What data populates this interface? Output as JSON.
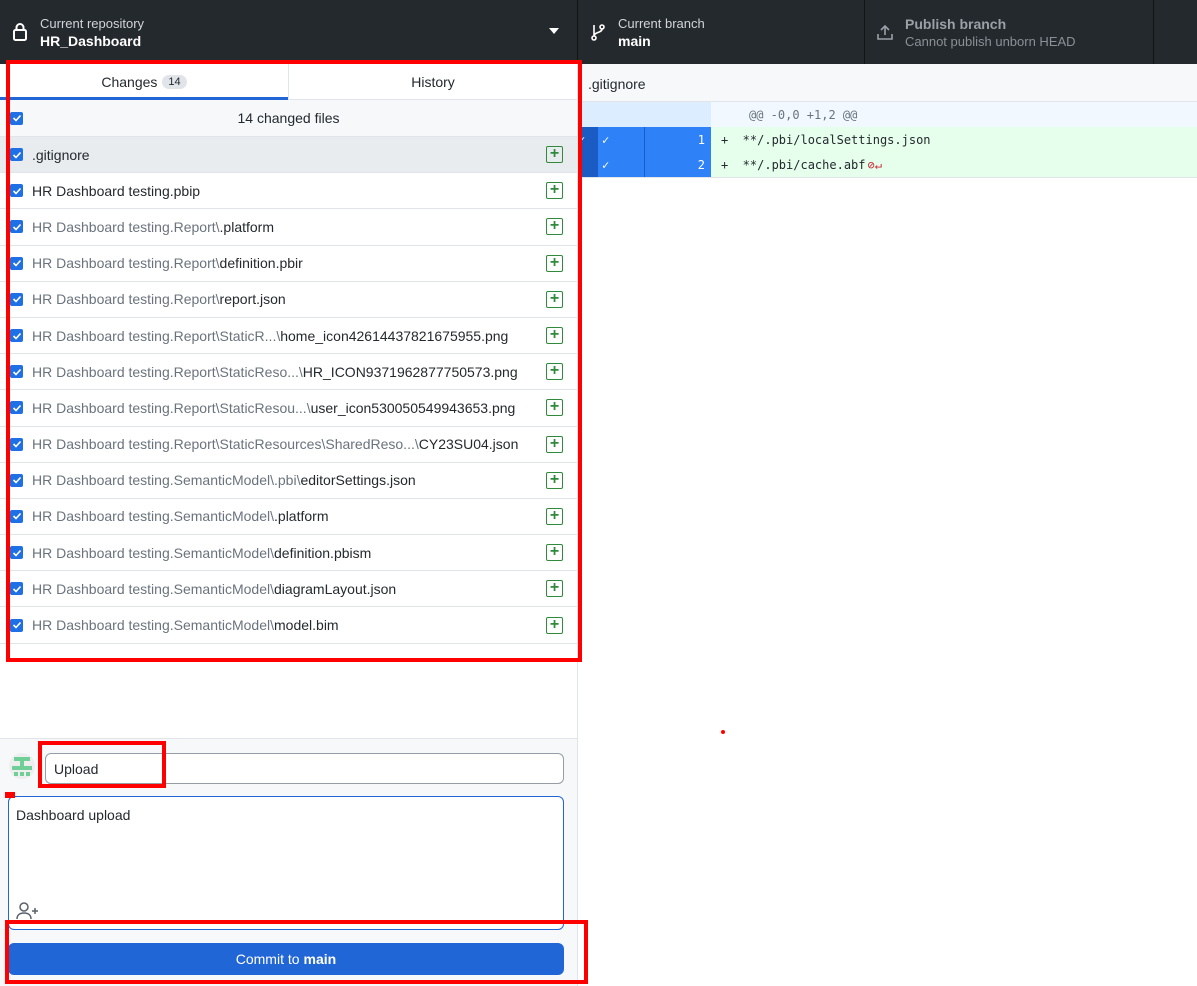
{
  "toolbar": {
    "repository": {
      "label": "Current repository",
      "value": "HR_Dashboard"
    },
    "branch": {
      "label": "Current branch",
      "value": "main"
    },
    "publish": {
      "label": "Publish branch",
      "value": "Cannot publish unborn HEAD"
    }
  },
  "tabs": {
    "changes": "Changes",
    "changes_count": "14",
    "history": "History"
  },
  "changes_header": "14 changed files",
  "files": [
    {
      "prefix": "",
      "name": ".gitignore"
    },
    {
      "prefix": "",
      "name": "HR Dashboard testing.pbip"
    },
    {
      "prefix": "HR Dashboard testing.Report\\",
      "name": ".platform"
    },
    {
      "prefix": "HR Dashboard testing.Report\\",
      "name": "definition.pbir"
    },
    {
      "prefix": "HR Dashboard testing.Report\\",
      "name": "report.json"
    },
    {
      "prefix": "HR Dashboard testing.Report\\StaticR...\\",
      "name": "home_icon42614437821675955.png"
    },
    {
      "prefix": "HR Dashboard testing.Report\\StaticReso...\\",
      "name": "HR_ICON9371962877750573.png"
    },
    {
      "prefix": "HR Dashboard testing.Report\\StaticResou...\\",
      "name": "user_icon530050549943653.png"
    },
    {
      "prefix": "HR Dashboard testing.Report\\StaticResources\\SharedReso...\\",
      "name": "CY23SU04.json"
    },
    {
      "prefix": "HR Dashboard testing.SemanticModel\\.pbi\\",
      "name": "editorSettings.json"
    },
    {
      "prefix": "HR Dashboard testing.SemanticModel\\",
      "name": ".platform"
    },
    {
      "prefix": "HR Dashboard testing.SemanticModel\\",
      "name": "definition.pbism"
    },
    {
      "prefix": "HR Dashboard testing.SemanticModel\\",
      "name": "diagramLayout.json"
    },
    {
      "prefix": "HR Dashboard testing.SemanticModel\\",
      "name": "model.bim"
    }
  ],
  "commit": {
    "summary": "Upload",
    "description": "Dashboard upload",
    "button_prefix": "Commit to",
    "button_branch": "main"
  },
  "diff": {
    "file": ".gitignore",
    "hunk": "@@ -0,0 +1,2 @@",
    "lines": [
      {
        "num": "1",
        "text": "+  **/.pbi/localSettings.json"
      },
      {
        "num": "2",
        "text": "+  **/.pbi/cache.abf"
      }
    ]
  },
  "colors": {
    "accent": "#2166d6",
    "added": "#2f8a3c",
    "annotation": "#ff0000"
  }
}
